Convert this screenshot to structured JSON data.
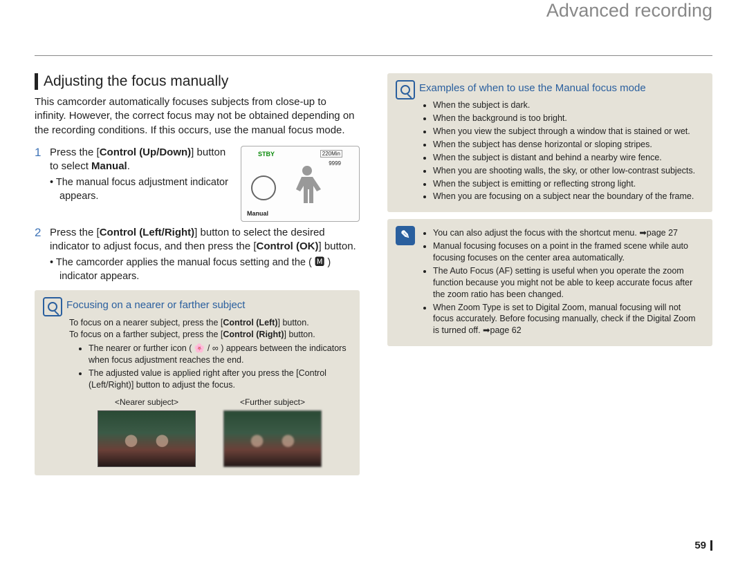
{
  "header": {
    "title": "Advanced recording"
  },
  "section": {
    "title": "Adjusting the focus manually",
    "intro": "This camcorder automatically focuses subjects from close-up to infinity. However, the correct focus may not be obtained depending on the recording conditions. If this occurs, use the manual focus mode."
  },
  "lcd": {
    "stby": "STBY",
    "min": "220Min",
    "count": "9999",
    "mode": "Manual"
  },
  "steps": [
    {
      "num": "1",
      "line_pre": "Press the [",
      "line_bold": "Control (Up/Down)",
      "line_post": "] button to select ",
      "line_bold2": "Manual",
      "line_post2": ".",
      "sub": "The manual focus adjustment indicator appears."
    },
    {
      "num": "2",
      "line_pre": "Press the [",
      "line_bold": "Control (Left/Right)",
      "line_post": "] button to select the desired indicator to adjust focus, and then press the [",
      "line_bold2": "Control (OK)",
      "line_post2": "] button.",
      "sub": "The camcorder applies the manual focus setting and the ( 🅼 ) indicator appears."
    }
  ],
  "box1": {
    "title": "Focusing on a nearer or farther subject",
    "line1_pre": "To focus on a nearer subject, press the [",
    "line1_bold": "Control (Left)",
    "line1_post": "] button.",
    "line2_pre": "To focus on a farther subject, press the [",
    "line2_bold": "Control (Right)",
    "line2_post": "] button.",
    "bullets": [
      "The nearer or further icon ( 🌸 / ∞ ) appears between the indicators when focus adjustment reaches the end.",
      "The adjusted value is applied right after you press the [Control (Left/Right)] button to adjust the focus."
    ],
    "thumb1_label": "<Nearer subject>",
    "thumb2_label": "<Further subject>"
  },
  "box2": {
    "title": "Examples of when to use the Manual focus mode",
    "bullets": [
      "When the subject is dark.",
      "When the background is too bright.",
      "When you view the subject through a window that is stained or wet.",
      "When the subject has dense horizontal or sloping stripes.",
      "When the subject is distant and behind a nearby wire fence.",
      "When you are shooting walls, the sky, or other low-contrast subjects.",
      "When the subject is emitting or reflecting strong light.",
      "When you are focusing on a subject near the boundary of the frame."
    ]
  },
  "box3": {
    "bullets": [
      "You can also adjust the focus with the shortcut menu. ➡page 27",
      "Manual focusing focuses on a point in the framed scene while auto focusing focuses on the center area automatically.",
      "The Auto Focus (AF) setting is useful when you operate the zoom function because you might not be able to keep accurate focus after the zoom ratio has been changed.",
      "When Zoom Type is set to Digital Zoom, manual focusing will not focus accurately. Before focusing manually, check if the Digital Zoom is turned off. ➡page 62"
    ]
  },
  "page_number": "59"
}
